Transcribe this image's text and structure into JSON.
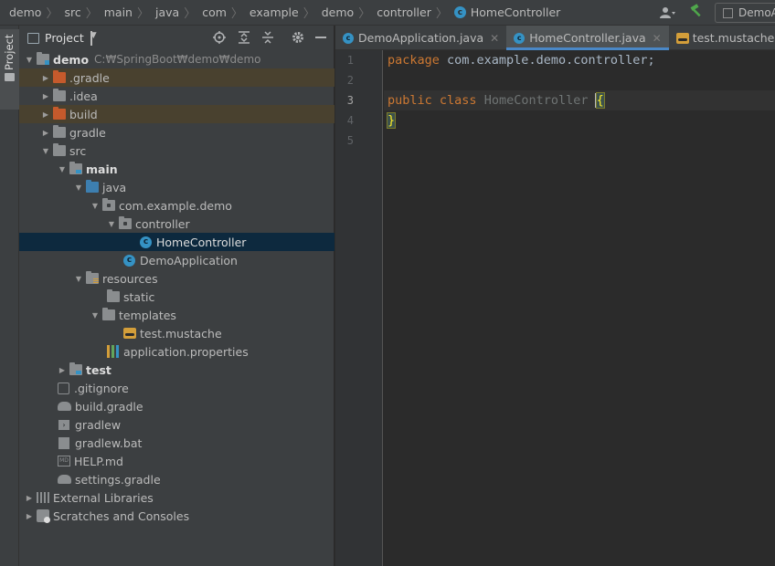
{
  "breadcrumb": [
    "demo",
    "src",
    "main",
    "java",
    "com",
    "example",
    "demo",
    "controller",
    "HomeController"
  ],
  "toolbar": {
    "run_config": "DemoApplication"
  },
  "tool_strip": {
    "project_label": "Project"
  },
  "project_panel": {
    "title": "Project",
    "tree": [
      {
        "label": "demo",
        "path": "C:₩SpringBoot₩demo₩demo"
      },
      {
        "label": ".gradle"
      },
      {
        "label": ".idea"
      },
      {
        "label": "build"
      },
      {
        "label": "gradle"
      },
      {
        "label": "src"
      },
      {
        "label": "main"
      },
      {
        "label": "java"
      },
      {
        "label": "com.example.demo"
      },
      {
        "label": "controller"
      },
      {
        "label": "HomeController"
      },
      {
        "label": "DemoApplication"
      },
      {
        "label": "resources"
      },
      {
        "label": "static"
      },
      {
        "label": "templates"
      },
      {
        "label": "test.mustache"
      },
      {
        "label": "application.properties"
      },
      {
        "label": "test"
      },
      {
        "label": ".gitignore"
      },
      {
        "label": "build.gradle"
      },
      {
        "label": "gradlew"
      },
      {
        "label": "gradlew.bat"
      },
      {
        "label": "HELP.md"
      },
      {
        "label": "settings.gradle"
      },
      {
        "label": "External Libraries"
      },
      {
        "label": "Scratches and Consoles"
      }
    ]
  },
  "editor": {
    "tabs": [
      {
        "label": "DemoApplication.java",
        "active": false
      },
      {
        "label": "HomeController.java",
        "active": true
      },
      {
        "label": "test.mustache",
        "active": false
      }
    ],
    "line_numbers": [
      "1",
      "2",
      "3",
      "4",
      "5"
    ],
    "code": {
      "l1_kw": "package",
      "l1_rest": " com.example.demo.controller;",
      "l3_kw1": "public",
      "l3_kw2": "class",
      "l3_name": "HomeController",
      "l3_brace": "{",
      "l4_brace": "}"
    }
  }
}
